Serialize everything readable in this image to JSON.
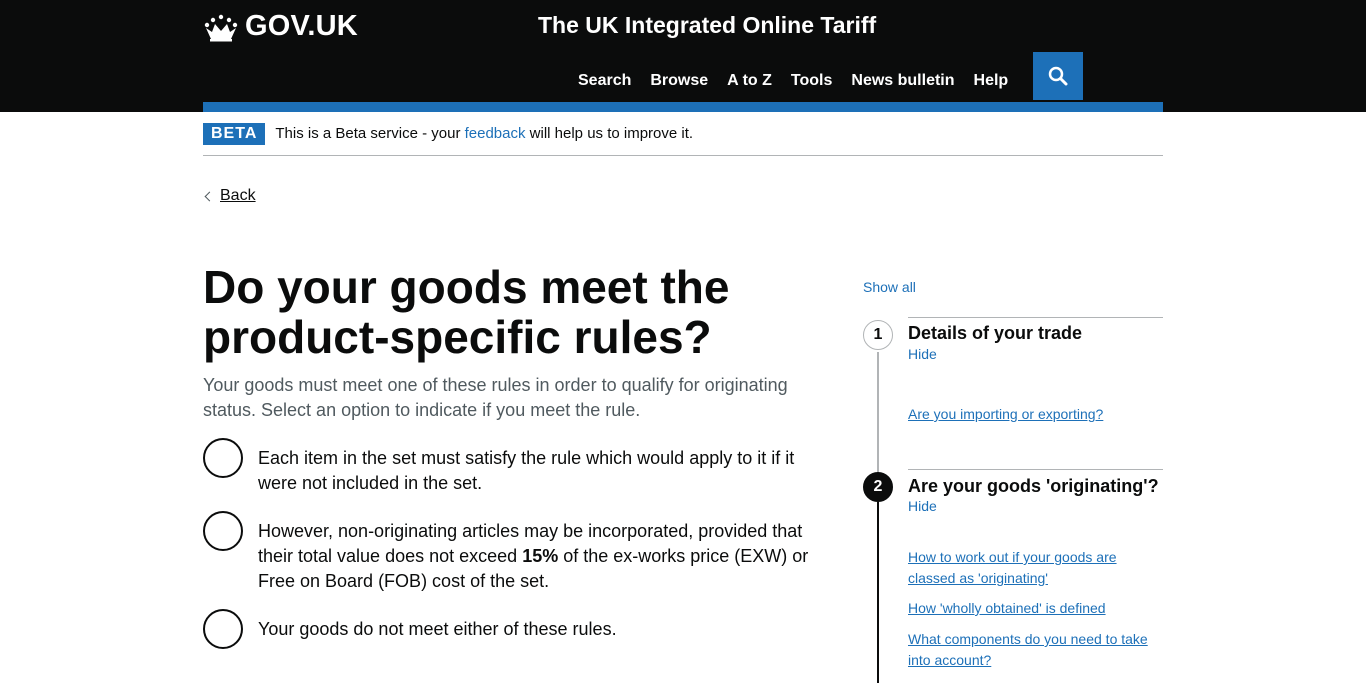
{
  "header": {
    "logo_text": "GOV.UK",
    "service_name": "The UK Integrated Online Tariff",
    "nav": [
      "Search",
      "Browse",
      "A to Z",
      "Tools",
      "News bulletin",
      "Help"
    ],
    "search_icon": "search-icon"
  },
  "phase_banner": {
    "tag": "BETA",
    "text_before": "This is a Beta service - your ",
    "link": "feedback",
    "text_after": " will help us to improve it."
  },
  "back_link": "Back",
  "page": {
    "title": "Do your goods meet the product-specific rules?",
    "lead": "Your goods must meet one of these rules in order to qualify for originating status. Select an option to indicate if you meet the rule.",
    "options": [
      {
        "text": "Each item in the set must satisfy the rule which would apply to it if it were not included in the set."
      },
      {
        "text_before": "However, non-originating articles may be incorporated, provided that their total value does not exceed ",
        "bold": "15%",
        "text_after": " of the ex-works price (EXW) or Free on Board (FOB) cost of the set."
      },
      {
        "text": "Your goods do not meet either of these rules."
      }
    ]
  },
  "sidebar": {
    "show_all": "Show all",
    "steps": [
      {
        "number": "1",
        "title": "Details of your trade",
        "toggle": "Hide",
        "links": [
          "Are you importing or exporting?"
        ]
      },
      {
        "number": "2",
        "title": "Are your goods 'originating'?",
        "toggle": "Hide",
        "links": [
          "How to work out if your goods are classed as 'originating'",
          "How 'wholly obtained' is defined",
          "What components do you need to take into account?"
        ]
      }
    ]
  },
  "colors": {
    "header_bg": "#0b0c0c",
    "brand_blue": "#1d70b8",
    "secondary_text": "#505a5f"
  }
}
